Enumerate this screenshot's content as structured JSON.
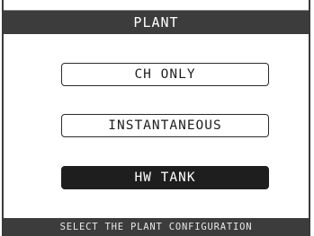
{
  "header": {
    "title": "PLANT"
  },
  "options": [
    {
      "label": "CH ONLY",
      "selected": false
    },
    {
      "label": "INSTANTANEOUS",
      "selected": false
    },
    {
      "label": "HW TANK",
      "selected": true
    }
  ],
  "footer": {
    "hint": "SELECT THE PLANT CONFIGURATION"
  },
  "colors": {
    "bar_background": "#3c3c3c",
    "selected_background": "#1e1e1e",
    "screen_background": "#ffffff"
  }
}
